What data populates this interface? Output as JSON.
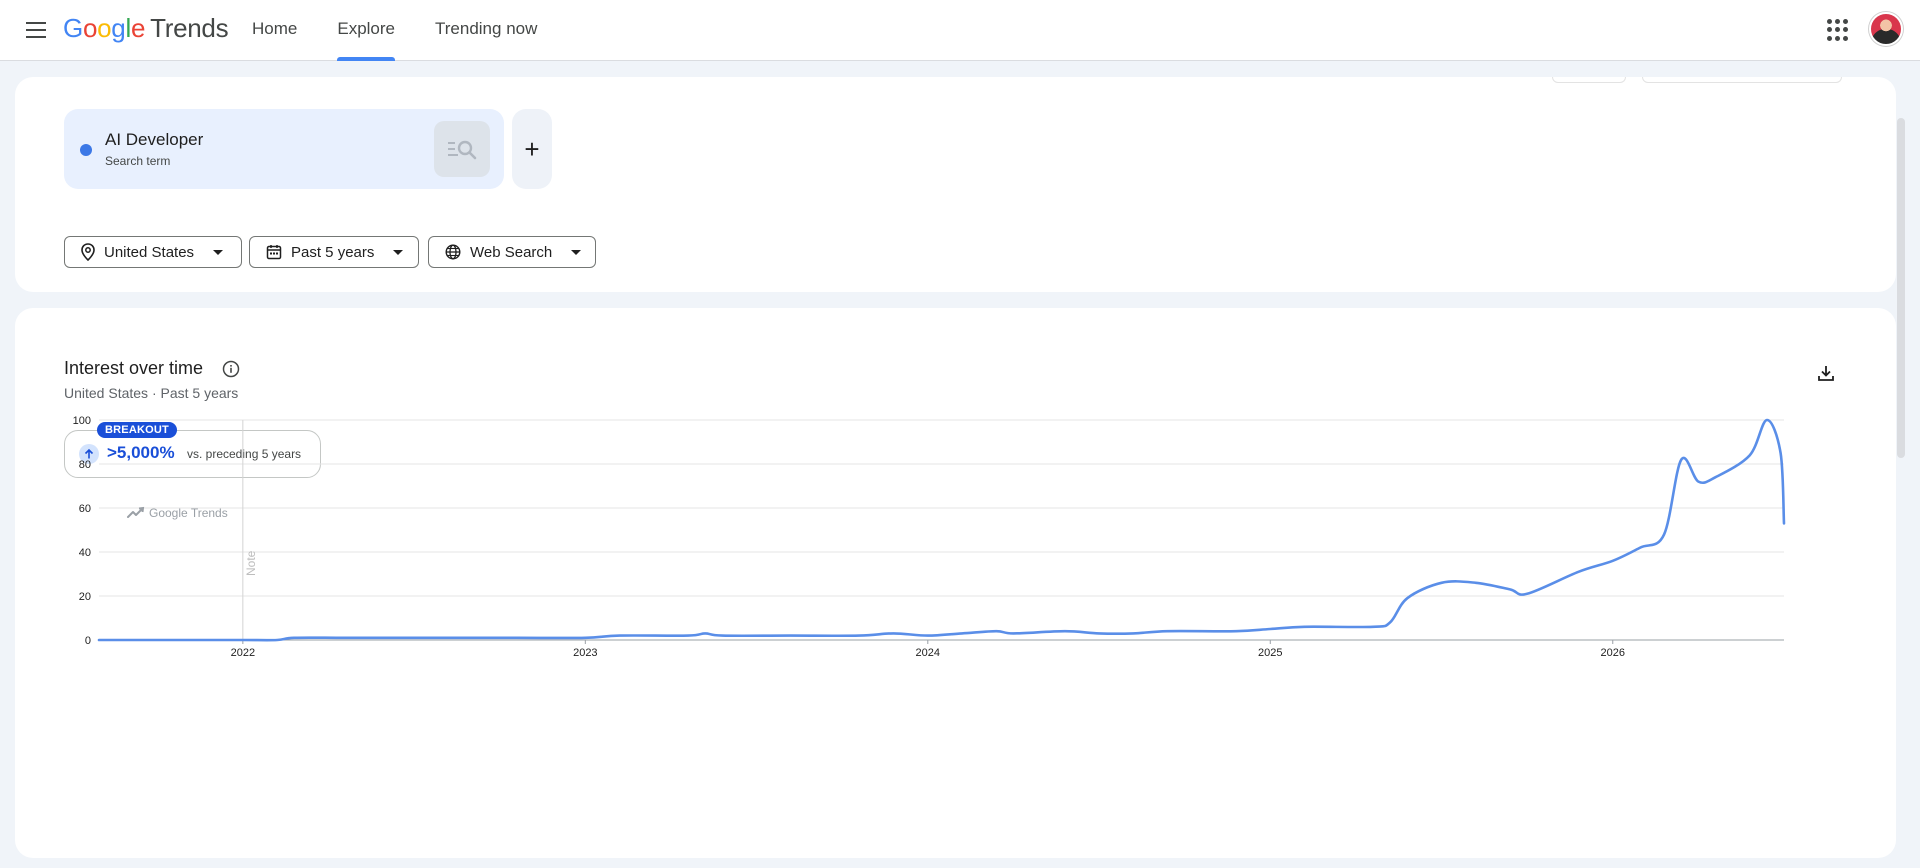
{
  "header": {
    "logo_google": [
      "G",
      "o",
      "o",
      "g",
      "l",
      "e"
    ],
    "logo_trends": "Trends",
    "nav": [
      {
        "label": "Home"
      },
      {
        "label": "Explore"
      },
      {
        "label": "Trending now"
      }
    ],
    "active_tab": "Explore"
  },
  "search": {
    "term": "AI Developer",
    "term_type": "Search term",
    "term_color": "#3c78e6",
    "add_label": "+",
    "filters": {
      "region": "United States",
      "period": "Past 5 years",
      "property": "Web Search"
    }
  },
  "interest": {
    "title": "Interest over time",
    "subtitle": "United States · Past 5 years",
    "badge": "BREAKOUT",
    "change": ">5,000%",
    "change_text": "vs. preceding 5 years",
    "watermark": "Google Trends",
    "note": "Note"
  },
  "colors": {
    "accent": "#4285f4",
    "line": "#5a8ee8",
    "breakout": "#1a4fd8"
  },
  "chart_data": {
    "type": "line",
    "ylim": [
      0,
      100
    ],
    "yticks": [
      0,
      20,
      40,
      60,
      80,
      100
    ],
    "xticks": [
      "2022",
      "2023",
      "2024",
      "2025",
      "2026"
    ],
    "series": [
      {
        "color": "#5a8ee8",
        "x": [
          2021.58,
          2021.7,
          2021.85,
          2022.0,
          2022.1,
          2022.15,
          2022.3,
          2022.5,
          2022.8,
          2023.0,
          2023.1,
          2023.3,
          2023.35,
          2023.4,
          2023.6,
          2023.8,
          2023.9,
          2024.0,
          2024.1,
          2024.2,
          2024.25,
          2024.4,
          2024.5,
          2024.6,
          2024.7,
          2024.9,
          2025.0,
          2025.1,
          2025.3,
          2025.35,
          2025.4,
          2025.5,
          2025.6,
          2025.7,
          2025.75,
          2025.9,
          2026.0,
          2026.08,
          2026.15,
          2026.2,
          2026.25,
          2026.3,
          2026.4,
          2026.45,
          2026.49,
          2026.5
        ],
        "y": [
          0,
          0,
          0,
          0,
          0,
          1,
          1,
          1,
          1,
          1,
          2,
          2,
          3,
          2,
          2,
          2,
          3,
          2,
          3,
          4,
          3,
          4,
          3,
          3,
          4,
          4,
          5,
          6,
          6,
          8,
          19,
          26,
          26,
          23,
          21,
          31,
          36,
          42,
          48,
          82,
          72,
          74,
          84,
          100,
          85,
          53
        ]
      }
    ]
  }
}
